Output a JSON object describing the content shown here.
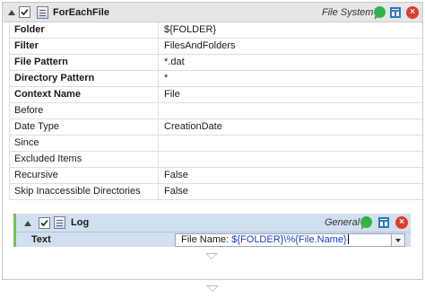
{
  "activity": {
    "title": "ForEachFile",
    "category": "File System",
    "properties": [
      {
        "key": "Folder",
        "bold": true,
        "value": "${FOLDER}"
      },
      {
        "key": "Filter",
        "bold": true,
        "value": "FilesAndFolders"
      },
      {
        "key": "File Pattern",
        "bold": true,
        "value": "*.dat"
      },
      {
        "key": "Directory Pattern",
        "bold": true,
        "value": "*"
      },
      {
        "key": "Context Name",
        "bold": true,
        "value": "File"
      },
      {
        "key": "Before",
        "bold": false,
        "value": ""
      },
      {
        "key": "Date Type",
        "bold": false,
        "value": "CreationDate"
      },
      {
        "key": "Since",
        "bold": false,
        "value": ""
      },
      {
        "key": "Excluded Items",
        "bold": false,
        "value": ""
      },
      {
        "key": "Recursive",
        "bold": false,
        "value": "False"
      },
      {
        "key": "Skip Inaccessible Directories",
        "bold": false,
        "value": "False"
      }
    ]
  },
  "child": {
    "title": "Log",
    "category": "General",
    "text_label": "Text",
    "text_prefix": "File Name: ",
    "text_expression": "${FOLDER}\\%{File.Name}"
  },
  "icons": {
    "collapse": "collapse-triangle-icon",
    "checkbox": "checkbox-checked-icon",
    "activity": "activity-icon",
    "comment": "comment-icon",
    "dock": "dock-icon",
    "close": "close-icon",
    "drop": "drop-target-arrow-icon"
  },
  "colors": {
    "header_bg": "#e6e6e6",
    "child_header_bg": "#d2dff0",
    "child_accent": "#76c442",
    "comment": "#35b34a",
    "close": "#df3b2f",
    "expression": "#1b3ec4"
  }
}
